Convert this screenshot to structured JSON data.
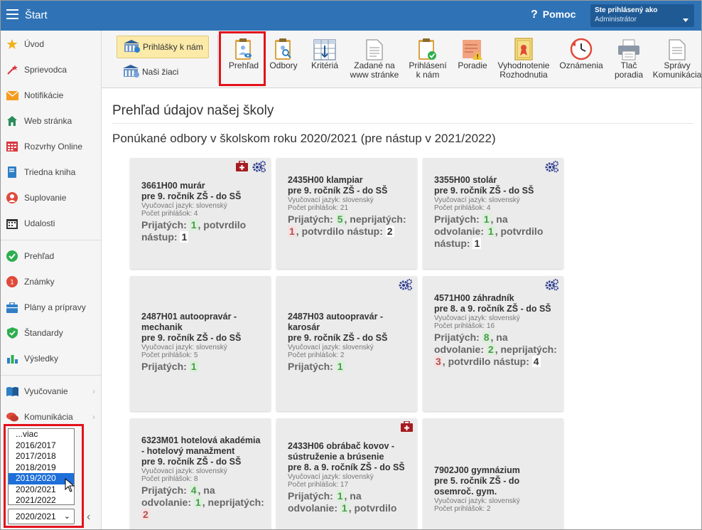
{
  "topbar": {
    "title": "Štart",
    "help_label": "Pomoc",
    "user_line1": "Ste prihlásený ako",
    "user_line2": "Administrátor"
  },
  "sidebar": {
    "items": [
      {
        "label": "Úvod"
      },
      {
        "label": "Sprievodca"
      },
      {
        "label": "Notifikácie"
      },
      {
        "label": "Web stránka"
      },
      {
        "label": "Rozvrhy Online"
      },
      {
        "label": "Triedna kniha"
      },
      {
        "label": "Suplovanie"
      },
      {
        "label": "Udalosti"
      },
      {
        "label": "Prehľad"
      },
      {
        "label": "Známky"
      },
      {
        "label": "Plány a prípravy"
      },
      {
        "label": "Štandardy"
      },
      {
        "label": "Výsledky"
      },
      {
        "label": "Vyučovanie"
      },
      {
        "label": "Komunikácia"
      }
    ],
    "year_options": [
      "...viac",
      "2016/2017",
      "2017/2018",
      "2018/2019",
      "2019/2020",
      "2020/2021",
      "2021/2022"
    ],
    "year_highlighted": "2019/2020",
    "year_selected": "2020/2021"
  },
  "toolbar": {
    "prihlasky_label": "Prihlášky k nám",
    "ziaci_label": "Naši žiaci",
    "tools": [
      {
        "label": "Prehľad"
      },
      {
        "label": "Odbory"
      },
      {
        "label": "Kritériá"
      },
      {
        "label": "Zadané na www stránke"
      },
      {
        "label": "Prihlásení k nám"
      },
      {
        "label": "Poradie"
      },
      {
        "label": "Vyhodnotenie Rozhodnutia"
      },
      {
        "label": "Oznámenia"
      },
      {
        "label": "Tlač poradia"
      },
      {
        "label": "Správy Komunikácia"
      }
    ]
  },
  "main": {
    "page_title": "Prehľad údajov našej školy",
    "section_title": "Ponúkané odbory v školskom roku 2020/2021 (pre nástup v 2021/2022)",
    "cards": [
      {
        "code_name": "3661H00 murár",
        "grade": "pre 9. ročník ZŠ - do SŠ",
        "lang": "Vyučovací jazyk: slovenský",
        "count": "Počet prihlášok: 4",
        "prijatych_label": "Prijatých:",
        "prijatych": "1",
        "potvrdilo_label": ", potvrdilo nástup:",
        "potvrdilo": "1"
      },
      {
        "code_name": "2435H00 klampiar",
        "grade": "pre 9. ročník ZŠ - do SŠ",
        "lang": "Vyučovací jazyk: slovenský",
        "count": "Počet prihlášok: 21",
        "prijatych_label": "Prijatých:",
        "prijatych": "5",
        "neprijatych_label": ", neprijatých:",
        "neprijatych": "1",
        "potvrdilo_label": ", potvrdilo nástup:",
        "potvrdilo": "2"
      },
      {
        "code_name": "3355H00 stolár",
        "grade": "pre 9. ročník ZŠ - do SŠ",
        "lang": "Vyučovací jazyk: slovenský",
        "count": "Počet prihlášok: 4",
        "prijatych_label": "Prijatých:",
        "prijatych": "1",
        "odvolanie_label": ", na odvolanie:",
        "odvolanie": "1",
        "potvrdilo_label": ", potvrdilo nástup:",
        "potvrdilo": "1"
      },
      {
        "code_name": "2487H01 autoopravár - mechanik",
        "grade": "pre 9. ročník ZŠ - do SŠ",
        "lang": "Vyučovací jazyk: slovenský",
        "count": "Počet prihlášok: 5",
        "prijatych_label": "Prijatých:",
        "prijatych": "1"
      },
      {
        "code_name": "2487H03 autoopravár - karosár",
        "grade": "pre 9. ročník ZŠ - do SŠ",
        "lang": "Vyučovací jazyk: slovenský",
        "count": "Počet prihlášok: 2",
        "prijatych_label": "Prijatých:",
        "prijatych": "1"
      },
      {
        "code_name": "4571H00 záhradník",
        "grade": "pre 8. a 9. ročník ZŠ - do SŠ",
        "lang": "Vyučovací jazyk: slovenský",
        "count": "Počet prihlášok: 16",
        "prijatych_label": "Prijatých:",
        "prijatych": "8",
        "odvolanie_label": ", na odvolanie:",
        "odvolanie": "2",
        "neprijatych_label": ", neprijatých:",
        "neprijatych": "3",
        "potvrdilo_label": ", potvrdilo nástup:",
        "potvrdilo": "4"
      },
      {
        "code_name": "6323M01 hotelová akadémia - hotelový manažment",
        "grade": "pre 9. ročník ZŠ - do SŠ",
        "lang": "Vyučovací jazyk: slovenský",
        "count": "Počet prihlášok: 8",
        "prijatych_label": "Prijatých:",
        "prijatych": "4",
        "odvolanie_label": ", na odvolanie:",
        "odvolanie": "1",
        "neprijatych_label": ", neprijatých:",
        "neprijatych": "2"
      },
      {
        "code_name": "2433H06 obrábač kovov - sústruženie a brúsenie",
        "grade": "pre 8. a 9. ročník ZŠ - do SŠ",
        "lang": "Vyučovací jazyk: slovenský",
        "count": "Počet prihlášok: 17",
        "prijatych_label": "Prijatých:",
        "prijatych": "1",
        "odvolanie_label": ", na odvolanie:",
        "odvolanie": "1",
        "potvrdilo_label": ", potvrdilo",
        "potvrdilo": ""
      },
      {
        "code_name": "7902J00 gymnázium",
        "grade": "pre 5. ročník ZŠ - do osemroč. gym.",
        "lang": "Vyučovací jazyk: slovenský",
        "count": "Počet prihlášok: 2"
      }
    ]
  },
  "colors": {
    "topbar": "#2f73b6",
    "highlight_outline": "#e3121b",
    "accepted": "#4a9a4a",
    "rejected": "#b05050"
  }
}
